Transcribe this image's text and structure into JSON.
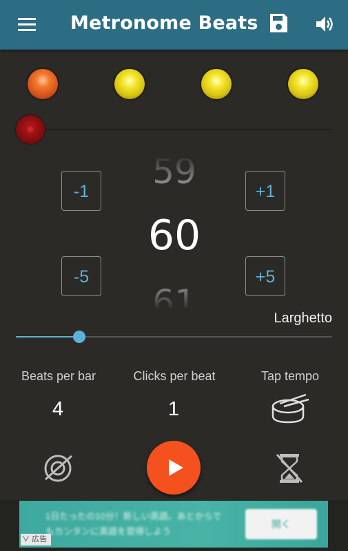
{
  "app": {
    "title": "Metronome Beats"
  },
  "icons": {
    "menu": "menu-icon",
    "save": "save-icon",
    "volume": "volume-icon",
    "drum": "drum-icon",
    "no_accent": "no-accent-icon",
    "timer_off": "timer-off-icon",
    "play": "play-icon"
  },
  "beats": [
    {
      "type": "accent"
    },
    {
      "type": "normal"
    },
    {
      "type": "normal"
    },
    {
      "type": "normal"
    }
  ],
  "tempo": {
    "minus1": "-1",
    "plus1": "+1",
    "minus5": "-5",
    "plus5": "+5",
    "prev": "59",
    "current": "60",
    "next": "61",
    "name": "Larghetto",
    "slider_fraction": 0.2
  },
  "settings": {
    "beats_label": "Beats per bar",
    "beats_value": "4",
    "clicks_label": "Clicks per beat",
    "clicks_value": "1",
    "tap_label": "Tap tempo"
  },
  "ad": {
    "text": "1日たったの10分！新しい英語。あとからでもカンタンに英語を習得しよう",
    "button": "開く",
    "badge": "広告"
  },
  "colors": {
    "appbar": "#2c6d83",
    "background": "#2b2a27",
    "accent": "#5fb0d9",
    "play": "#f4511e"
  }
}
